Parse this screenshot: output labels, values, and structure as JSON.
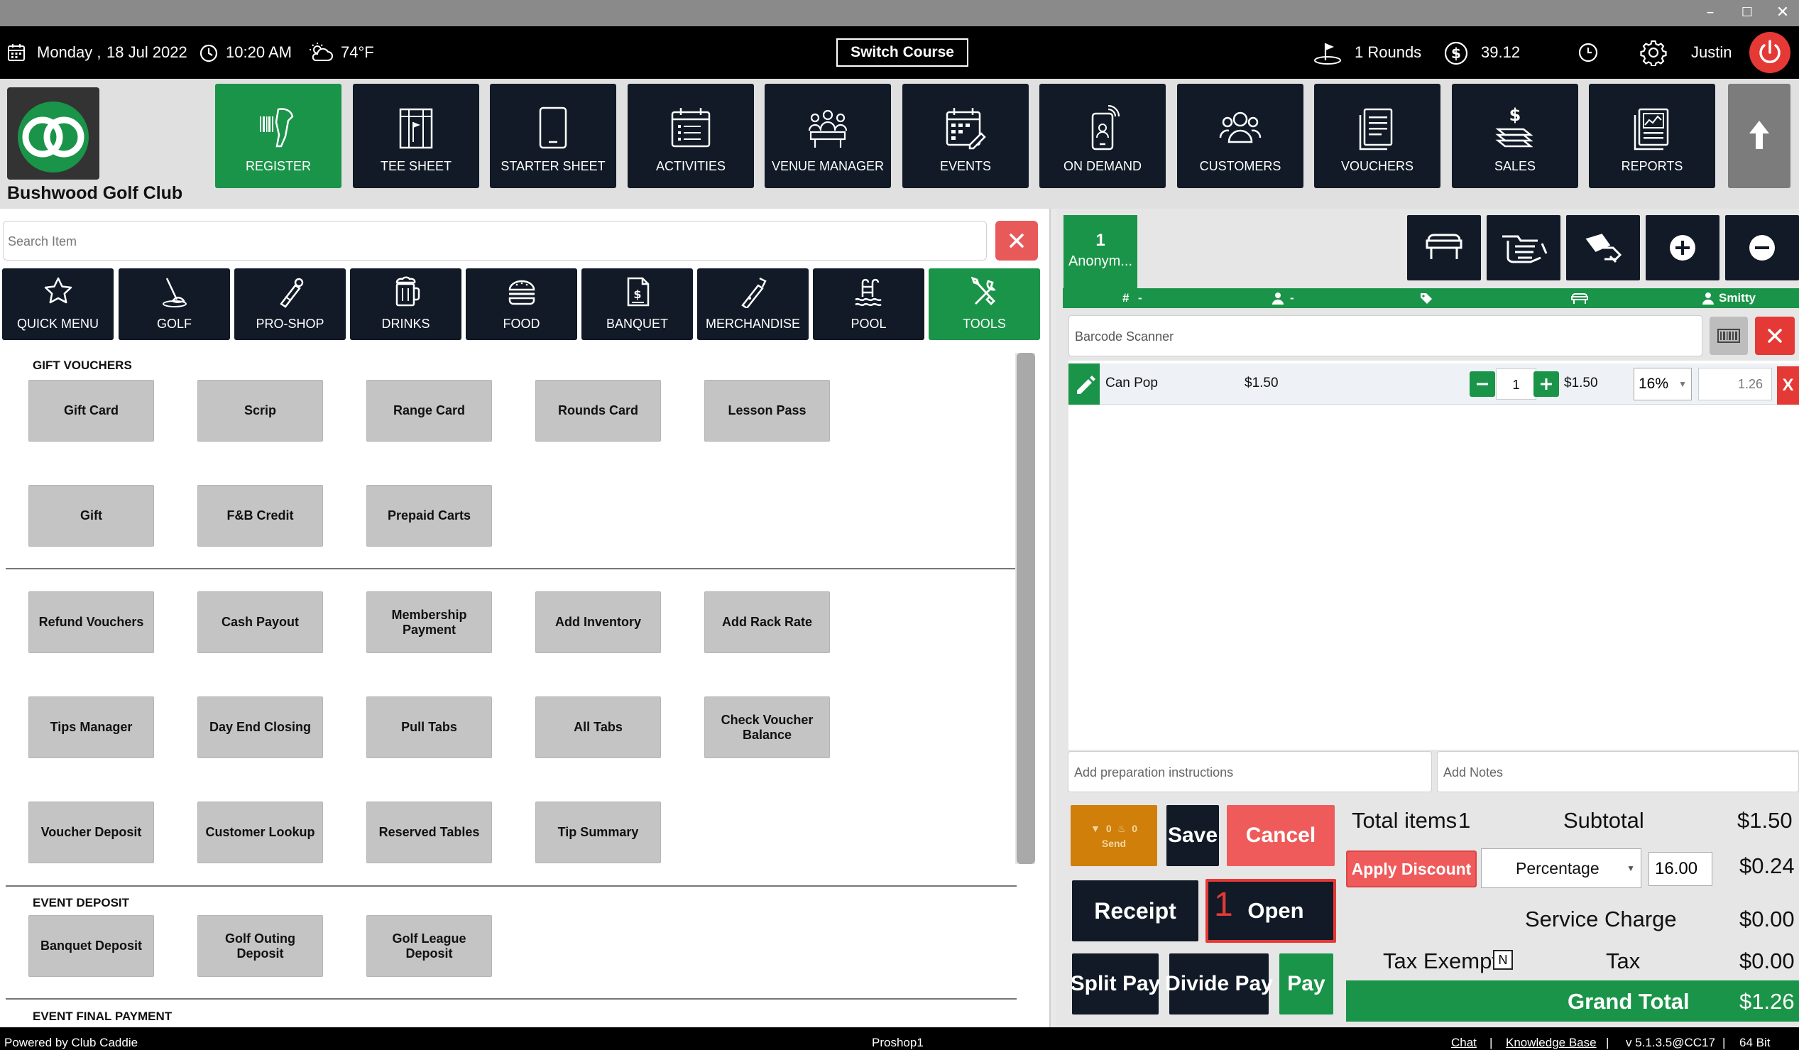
{
  "header": {
    "day": "Monday ,",
    "date": "18 Jul 2022",
    "time": "10:20 AM",
    "weather": "74°F",
    "switch_course": "Switch Course",
    "rounds": "1 Rounds",
    "balance": "39.12",
    "user": "Justin"
  },
  "club": {
    "name": "Bushwood Golf Club"
  },
  "nav": {
    "tiles": [
      {
        "label": "REGISTER"
      },
      {
        "label": "TEE SHEET"
      },
      {
        "label": "STARTER SHEET"
      },
      {
        "label": "ACTIVITIES"
      },
      {
        "label": "VENUE MANAGER"
      },
      {
        "label": "EVENTS"
      },
      {
        "label": "ON DEMAND"
      },
      {
        "label": "CUSTOMERS"
      },
      {
        "label": "VOUCHERS"
      },
      {
        "label": "SALES"
      },
      {
        "label": "REPORTS"
      }
    ]
  },
  "search": {
    "placeholder": "Search Item"
  },
  "categories": [
    {
      "label": "QUICK MENU"
    },
    {
      "label": "GOLF"
    },
    {
      "label": "PRO-SHOP"
    },
    {
      "label": "DRINKS"
    },
    {
      "label": "FOOD"
    },
    {
      "label": "BANQUET"
    },
    {
      "label": "MERCHANDISE"
    },
    {
      "label": "POOL"
    },
    {
      "label": "TOOLS"
    }
  ],
  "grid": {
    "gift_vouchers_title": "GIFT VOUCHERS",
    "gift_vouchers": [
      "Gift Card",
      "Scrip",
      "Range Card",
      "Rounds Card",
      "Lesson Pass",
      "Gift",
      "F&B Credit",
      "Prepaid Carts"
    ],
    "tools": [
      "Refund Vouchers",
      "Cash Payout",
      "Membership Payment",
      "Add Inventory",
      "Add Rack Rate",
      "Tips Manager",
      "Day End Closing",
      "Pull Tabs",
      "All Tabs",
      "Check Voucher Balance",
      "Voucher Deposit",
      "Customer Lookup",
      "Reserved Tables",
      "Tip Summary"
    ],
    "event_deposit_title": "EVENT DEPOSIT",
    "event_deposit": [
      "Banquet Deposit",
      "Golf Outing Deposit",
      "Golf League Deposit"
    ],
    "event_final_title": "EVENT FINAL PAYMENT"
  },
  "order": {
    "tab_number": "1",
    "tab_name": "Anonym...",
    "bar": {
      "table": "-",
      "guest": "-",
      "server": "Smitty"
    },
    "barcode_placeholder": "Barcode Scanner",
    "items": [
      {
        "name": "Can Pop",
        "price": "$1.50",
        "qty": "1",
        "amount": "$1.50",
        "tax": "16%",
        "total": "1.26",
        "delete": "X"
      }
    ],
    "prep_placeholder": "Add preparation instructions",
    "notes_placeholder": "Add Notes"
  },
  "actions": {
    "send_counts": [
      "0",
      "0"
    ],
    "send": "Send",
    "save": "Save",
    "cancel": "Cancel",
    "receipt": "Receipt",
    "open_count": "1",
    "open": "Open",
    "split_pay": "Split Pay",
    "divide_pay": "Divide Pay",
    "pay": "Pay"
  },
  "totals": {
    "total_items_label": "Total items",
    "total_items": "1",
    "subtotal_label": "Subtotal",
    "subtotal": "$1.50",
    "apply_discount": "Apply Discount",
    "discount_type": "Percentage",
    "discount_value": "16.00",
    "discount_amount": "$0.24",
    "service_charge_label": "Service Charge",
    "service_charge": "$0.00",
    "tax_exempt_label": "Tax Exempt",
    "tax_exempt_value": "N",
    "tax_label": "Tax",
    "tax": "$0.00",
    "grand_total_label": "Grand Total",
    "grand_total": "$1.26"
  },
  "footer": {
    "powered": "Powered by Club Caddie",
    "station": "Proshop1",
    "chat": "Chat",
    "sep": "|",
    "kb": "Knowledge Base",
    "version": "v 5.1.3.5@CC17",
    "bits": "64 Bit"
  },
  "colors": {
    "accent_green": "#1a9448",
    "navy": "#111a26",
    "danger": "#e53935",
    "send_orange": "#cf7f0a"
  }
}
